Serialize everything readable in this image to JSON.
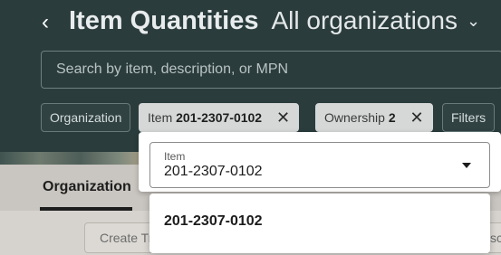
{
  "header": {
    "back_icon": "chevron-left-icon",
    "title": "Item Quantities",
    "scope": "All organizations",
    "scope_icon": "chevron-down-icon"
  },
  "search": {
    "placeholder": "Search by item, description, or MPN"
  },
  "filters": {
    "organization_label": "Organization",
    "item_label": "Item",
    "item_value": "201-2307-0102",
    "ownership_label": "Ownership",
    "ownership_count": "2",
    "filters_label": "Filters",
    "clear_icon": "close-icon"
  },
  "tabs": {
    "active": "Organization"
  },
  "actions": {
    "create_label": "Create Tr",
    "right_label": "sc"
  },
  "item_popup": {
    "field_label": "Item",
    "field_value": "201-2307-0102",
    "caret_icon": "caret-down-icon",
    "options": [
      "201-2307-0102"
    ]
  }
}
